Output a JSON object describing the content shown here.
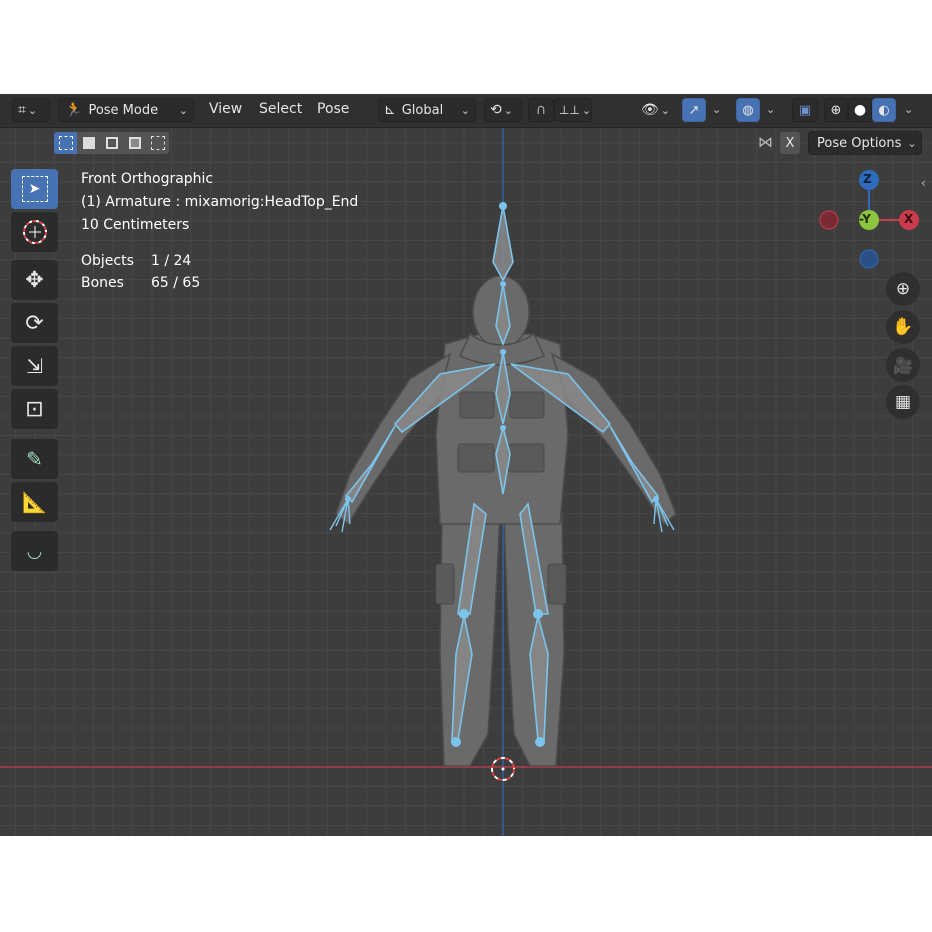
{
  "header": {
    "editor_type_icon": "grid-editor-icon",
    "mode_label": "Pose Mode",
    "menus": [
      "View",
      "Select",
      "Pose"
    ],
    "transform_orientation": "Global",
    "snapping_icon": "magnet-icon",
    "proportional_icon": "proportional-icon"
  },
  "subheader": {
    "x_mirror_label": "X",
    "pose_options_label": "Pose Options"
  },
  "viewport_info": {
    "view_name": "Front Orthographic",
    "active_object": "(1) Armature : mixamorig:HeadTop_End",
    "scale": "10 Centimeters",
    "objects_label": "Objects",
    "objects_value": "1 / 24",
    "bones_label": "Bones",
    "bones_value": "65 / 65"
  },
  "gizmo": {
    "z_label": "Z",
    "y_label": "-Y",
    "x_label": "X"
  },
  "colors": {
    "viewport_bg": "#3d3d3d",
    "header_bg": "#303030",
    "accent_blue": "#4772b3",
    "bone_selected": "#7cc4ec",
    "axis_red": "#c83c4c",
    "axis_blue": "#2f6bbd"
  }
}
